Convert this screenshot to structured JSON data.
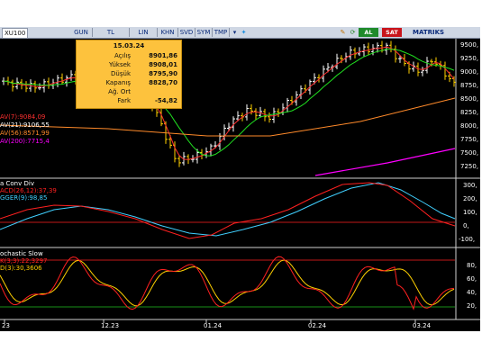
{
  "toolbar": {
    "symbol": "XU100",
    "buttons": [
      "GUN",
      "TL",
      "LIN",
      "KHN",
      "SVD",
      "SYM",
      "TMP"
    ],
    "buy_label": "AL",
    "sell_label": "SAT",
    "brand": "MATRIKS",
    "colors": {
      "buy": "#1f8a2b",
      "sell": "#c8141b"
    }
  },
  "info_box": {
    "date": "15.03.24",
    "rows": [
      {
        "label": "Açılış",
        "value": "8901,86"
      },
      {
        "label": "Yüksek",
        "value": "8908,01"
      },
      {
        "label": "Düşük",
        "value": "8795,90"
      },
      {
        "label": "Kapanış",
        "value": "8828,70"
      },
      {
        "label": "Ağ. Ort",
        "value": ""
      },
      {
        "label": "Fark",
        "value": "-54,82"
      }
    ]
  },
  "price_panel": {
    "legend": [
      {
        "text": "AV(7)",
        "value": ":9084,09",
        "color": "#ff3030"
      },
      {
        "text": "AV(21)",
        "value": ":9106,55",
        "color": "#ffffff"
      },
      {
        "text": "AV(56)",
        "value": ":8571,99",
        "color": "#ff8a2a"
      },
      {
        "text": "AV(200)",
        "value": ":7715,4",
        "color": "#ff00ff"
      }
    ],
    "y_ticks": [
      "9500,",
      "9250,",
      "9000,",
      "8750,",
      "8500,",
      "8250,",
      "8000,",
      "7750,",
      "7500,",
      "7250,"
    ]
  },
  "macd_panel": {
    "title": "a Conv Div",
    "legend": [
      {
        "text": "ACD(26,12)",
        "value": ":37,39",
        "color": "#ff2020"
      },
      {
        "text": "GGER(9)",
        "value": ":98,85",
        "color": "#40d0ff"
      }
    ],
    "y_ticks": [
      "300,",
      "200,",
      "100,",
      "0,",
      "-100,"
    ]
  },
  "stoch_panel": {
    "title": "ochastic Slow",
    "legend": [
      {
        "text": "K(3,3)",
        "value": ":22,3297",
        "color": "#ff2020"
      },
      {
        "text": "D(3)",
        "value": ":30,3606",
        "color": "#ffd000"
      }
    ],
    "y_ticks": [
      "80,",
      "60,",
      "40,",
      "20,"
    ]
  },
  "x_axis": [
    "23",
    "12.23",
    "01.24",
    "02.24",
    "03.24"
  ],
  "colors": {
    "bg": "#000000",
    "bull": "#ffffff",
    "bear": "#ffd000"
  }
}
